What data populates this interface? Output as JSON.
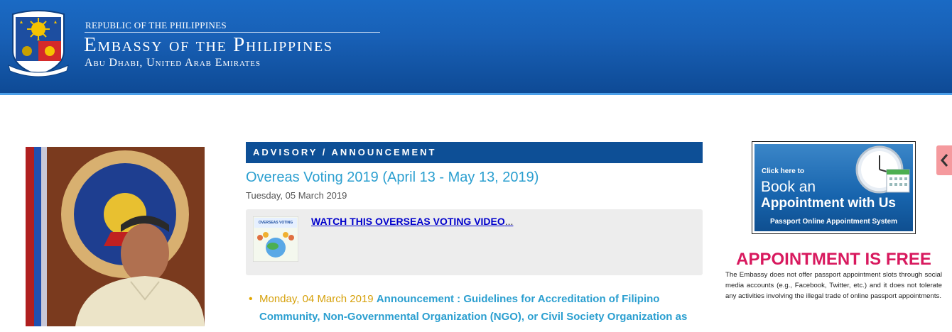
{
  "header": {
    "top_line": "Republic of the Philippines",
    "title": "Embassy of the Philippines",
    "subtitle": "Abu Dhabi, United Arab Emirates",
    "seal_text": "REPUBLIC OF THE PHILIPPINES"
  },
  "advisory": {
    "bar_label": "ADVISORY / ANNOUNCEMENT",
    "title": "Overeas Voting 2019 (April 13 - May 13, 2019)",
    "date": "Tuesday, 05 March 2019",
    "thumb_text": "OVERSEAS VOTING",
    "link_text": "WATCH THIS OVERSEAS VOTING VIDEO",
    "ellipsis": "..."
  },
  "announcements": [
    {
      "date": "Monday, 04 March 2019",
      "title": "Announcement : Guidelines for Accreditation of Filipino Community, Non-Governmental Organization (NGO), or Civil Society Organization as"
    }
  ],
  "sidebar": {
    "ad": {
      "click": "Click here to",
      "book": "Book an",
      "with": "Appointment with Us",
      "system": "Passport Online Appointment System"
    },
    "free_title": "APPOINTMENT IS FREE",
    "free_text": "The Embassy does not offer passport appointment slots through social media accounts (e.g., Facebook, Twitter, etc.) and it does not tolerate any activities involving the illegal trade of online passport appointments."
  },
  "colors": {
    "header_blue": "#1860b6",
    "bar_blue": "#0d4f96",
    "link_cyan": "#2b9fd0",
    "date_gold": "#d6a10c",
    "free_red": "#d8195e"
  },
  "icons": {
    "side_tab": "chevron-left-icon",
    "seal": "philippine-seal-icon"
  }
}
